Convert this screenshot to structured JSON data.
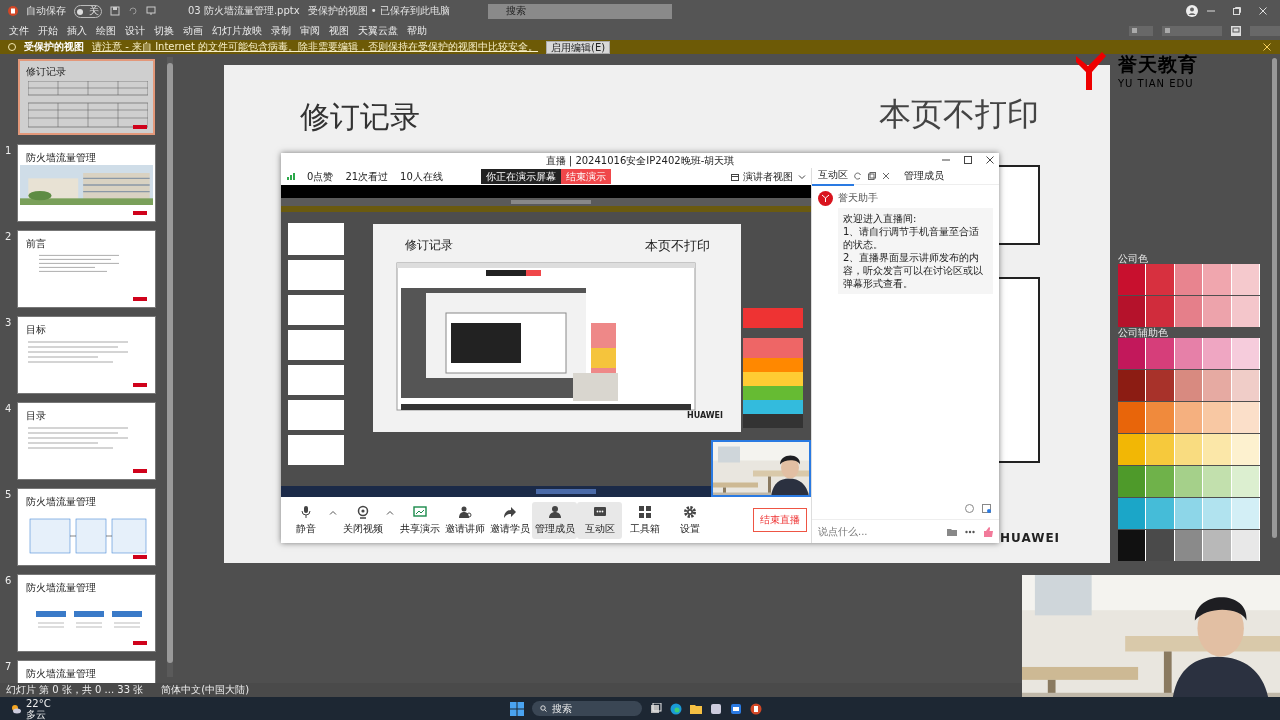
{
  "app": {
    "autosave_label": "自动保存",
    "autosave_toggle": "关",
    "autosave_on": false,
    "file_name": "03 防火墙流量管理.pptx",
    "file_status": "受保护的视图 • 已保存到此电脑",
    "search_placeholder": "搜索"
  },
  "ribbon_tabs": [
    "文件",
    "开始",
    "插入",
    "绘图",
    "设计",
    "切换",
    "动画",
    "幻灯片放映",
    "录制",
    "审阅",
    "视图",
    "天翼云盘",
    "帮助"
  ],
  "protected_bar": {
    "title": "受保护的视图",
    "message": "请注意 - 来自 Internet 的文件可能包含病毒。除非需要编辑，否则保持在受保护的视图中比较安全。",
    "button": "启用编辑(E)"
  },
  "thumbnails": [
    {
      "title": "修订记录",
      "kind": "table",
      "selected": true
    },
    {
      "number": "1",
      "title": "防火墙流量管理",
      "kind": "cover",
      "selected": false
    },
    {
      "number": "2",
      "title": "前言",
      "kind": "text",
      "selected": false
    },
    {
      "number": "3",
      "title": "目标",
      "kind": "list",
      "selected": false
    },
    {
      "number": "4",
      "title": "目录",
      "kind": "list",
      "selected": false
    },
    {
      "number": "5",
      "title": "防火墙流量管理",
      "kind": "diagram",
      "selected": false
    },
    {
      "number": "6",
      "title": "防火墙流量管理",
      "kind": "columns",
      "selected": false
    },
    {
      "number": "7",
      "title": "防火墙流量管理",
      "kind": "cut",
      "selected": false
    }
  ],
  "slide": {
    "title": "修订记录",
    "note": "本页不打印",
    "logo_cn": "誉天教育",
    "logo_en": "YU TIAN EDU",
    "brand": "HUAWEI"
  },
  "palette": [
    {
      "title": "公司色",
      "rows": [
        [
          {
            "color": "#c8102e"
          },
          {
            "color": "#d7303f"
          },
          {
            "color": "#e8848f"
          },
          {
            "color": "#f0a6ae"
          },
          {
            "color": "#f5c9cd"
          }
        ],
        [
          {
            "color": "#b5122b"
          },
          {
            "color": "#d02c3c"
          },
          {
            "color": "#e57f8a"
          },
          {
            "color": "#eda3ab"
          },
          {
            "color": "#f4c6cb"
          }
        ]
      ]
    },
    {
      "title": "公司辅助色",
      "rows": [
        [
          {
            "color": "#c2185b"
          },
          {
            "color": "#d63e7a"
          },
          {
            "color": "#e680a8"
          },
          {
            "color": "#efa6c2"
          },
          {
            "color": "#f6ccdc"
          }
        ],
        [
          {
            "color": "#8c1c13"
          },
          {
            "color": "#a8322a"
          },
          {
            "color": "#d88a80"
          },
          {
            "color": "#e6aaa2"
          },
          {
            "color": "#f0cdc8"
          }
        ],
        [
          {
            "color": "#e8650a"
          },
          {
            "color": "#f08a3c"
          },
          {
            "color": "#f5b07f"
          },
          {
            "color": "#f8c8a3"
          },
          {
            "color": "#fbdfc9"
          }
        ],
        [
          {
            "color": "#f2b705"
          },
          {
            "color": "#f6c93c"
          },
          {
            "color": "#f9dc80"
          },
          {
            "color": "#fbe7a8"
          },
          {
            "color": "#fdf1cf"
          }
        ],
        [
          {
            "color": "#4e9a2a"
          },
          {
            "color": "#6fb24a"
          },
          {
            "color": "#a5d08a"
          },
          {
            "color": "#c2e0ad"
          },
          {
            "color": "#dcefd0"
          }
        ],
        [
          {
            "color": "#1ba6c8"
          },
          {
            "color": "#45bcd8"
          },
          {
            "color": "#8dd6e8"
          },
          {
            "color": "#b1e3ef"
          },
          {
            "color": "#d3eff6"
          }
        ],
        [
          {
            "color": "#111111"
          },
          {
            "color": "#4a4a4a"
          },
          {
            "color": "#8a8a8a"
          },
          {
            "color": "#b8b8b8"
          },
          {
            "color": "#e8e8e8"
          }
        ]
      ]
    }
  ],
  "live": {
    "title": "直播 | 20241016安全IP2402晚班-胡天琪",
    "stats": [
      "0点赞",
      "21次看过",
      "10人在线"
    ],
    "presenting": "你正在演示屏幕",
    "stop_button": "结束演示",
    "view_label": "演讲者视图",
    "capture": {
      "title": "修订记录",
      "note": "本页不打印",
      "brand": "HUAWEI"
    },
    "side_tabs": [
      {
        "label": "互动区",
        "selected": true
      },
      {
        "label": "管理成员",
        "selected": false
      }
    ],
    "chat": [
      {
        "sender": "誉天助手",
        "lines": [
          "欢迎进入直播间:",
          "1、请自行调节手机音量至合适的状态。",
          "2、直播界面显示讲师发布的内容，听众发言可以在讨论区或以弹幕形式查看。"
        ]
      }
    ],
    "input_placeholder": "说点什么...",
    "tools": [
      {
        "label": "静音",
        "kind": "mic",
        "caret": true,
        "selected": false
      },
      {
        "label": "关闭视频",
        "kind": "camera",
        "caret": true,
        "selected": false
      },
      {
        "label": "共享演示",
        "kind": "share",
        "caret": false,
        "selected": false
      },
      {
        "label": "邀请讲师",
        "kind": "teacher",
        "caret": false,
        "selected": false
      },
      {
        "label": "邀请学员",
        "kind": "forward",
        "caret": false,
        "selected": false
      },
      {
        "label": "管理成员",
        "kind": "person",
        "caret": false,
        "selected": true
      },
      {
        "label": "互动区",
        "kind": "chat",
        "caret": false,
        "selected": true
      },
      {
        "label": "工具箱",
        "kind": "grid",
        "caret": false,
        "selected": false
      },
      {
        "label": "设置",
        "kind": "gear",
        "caret": false,
        "selected": false
      }
    ],
    "end_button": "结束直播"
  },
  "status_bar": {
    "slide_info": "幻灯片 第 0 张，共 0 ... 33 张",
    "language": "简体中文(中国大陆)"
  },
  "taskbar": {
    "temperature": "22°C",
    "weather": "多云",
    "search": "搜索"
  }
}
